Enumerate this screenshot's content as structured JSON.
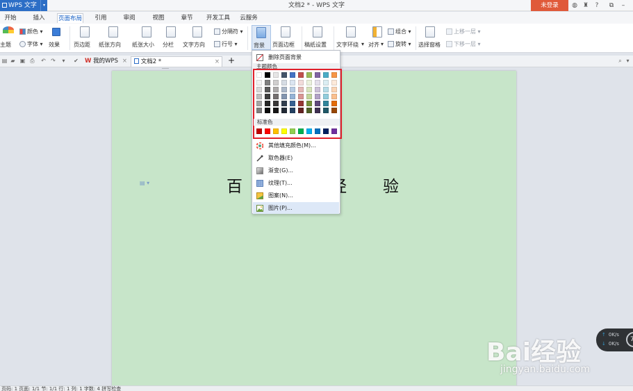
{
  "titlebar": {
    "app_menu": "WPS 文字",
    "window_title": "文档2 * - WPS 文字",
    "login": "未登录"
  },
  "menu_tabs": [
    "开始",
    "插入",
    "页面布局",
    "引用",
    "审阅",
    "视图",
    "章节",
    "开发工具",
    "云服务"
  ],
  "active_tab": "页面布局",
  "ribbon": {
    "theme": "主题",
    "colors": "颜色",
    "fonts": "字体",
    "effects": "效果",
    "margins": "页边距",
    "orientation": "纸张方向",
    "size": "纸张大小",
    "columns": "分栏",
    "text_direction": "文字方向",
    "breaks": "分隔符",
    "line_numbers": "行号",
    "background": "背景",
    "page_border": "页面边框",
    "manuscript": "稿纸设置",
    "wrap": "文字环绕",
    "align": "对齐",
    "group": "组合",
    "rotate": "旋转",
    "selection_pane": "选择窗格",
    "bring_forward": "上移一层",
    "send_backward": "下移一层"
  },
  "doc_tabs": {
    "home": "我的WPS",
    "doc": "文档2 *",
    "add": "+"
  },
  "document": {
    "chars": [
      "百",
      "经",
      "验"
    ]
  },
  "dropdown": {
    "remove_bg": "删除页面背景",
    "theme_colors_label": "主题颜色",
    "standard_colors_label": "标准色",
    "more_colors": "其他填充颜色(M)...",
    "picker": "取色器(E)",
    "gradient": "渐变(G)...",
    "texture": "纹理(T)...",
    "pattern": "图案(N)...",
    "picture": "图片(P)..."
  },
  "theme_colors": [
    [
      "#ffffff",
      "#000000",
      "#e7e6e6",
      "#44546a",
      "#4472c4",
      "#c0504d",
      "#9bbb59",
      "#8064a2",
      "#4bacc6",
      "#f79646"
    ],
    [
      "#f2f2f2",
      "#7f7f7f",
      "#d0cece",
      "#d6dce4",
      "#dbe5f1",
      "#f2dcdb",
      "#ebf1dd",
      "#e5e0ec",
      "#dbeef3",
      "#fdeada"
    ],
    [
      "#d8d8d8",
      "#595959",
      "#aeabab",
      "#adb9ca",
      "#b8cce4",
      "#e5b9b7",
      "#d7e3bc",
      "#ccc1d9",
      "#b7dde8",
      "#fbd5b5"
    ],
    [
      "#bfbfbf",
      "#3f3f3f",
      "#757070",
      "#8496b0",
      "#95b3d7",
      "#d99694",
      "#c3d69b",
      "#b2a2c7",
      "#92cddc",
      "#fac08f"
    ],
    [
      "#a5a5a5",
      "#262626",
      "#3a3838",
      "#333f4f",
      "#366092",
      "#953734",
      "#76923c",
      "#5f497a",
      "#31859b",
      "#e36c09"
    ],
    [
      "#7f7f7f",
      "#0c0c0c",
      "#171616",
      "#222a35",
      "#244061",
      "#632423",
      "#4f6128",
      "#3f3151",
      "#205867",
      "#974806"
    ]
  ],
  "standard_colors": [
    "#c00000",
    "#ff0000",
    "#ffc000",
    "#ffff00",
    "#92d050",
    "#00b050",
    "#00b0f0",
    "#0070c0",
    "#002060",
    "#7030a0"
  ],
  "netwidget": {
    "up": "0K/s",
    "down": "0K/s",
    "ring": "7"
  },
  "watermark": {
    "logo": "Bai经验",
    "url": "jingyan.baidu.com"
  },
  "statusbar": {
    "text": "页码: 1  页面: 1/1  节: 1/1  行: 1  列: 1  字数: 4  拼写检查"
  }
}
